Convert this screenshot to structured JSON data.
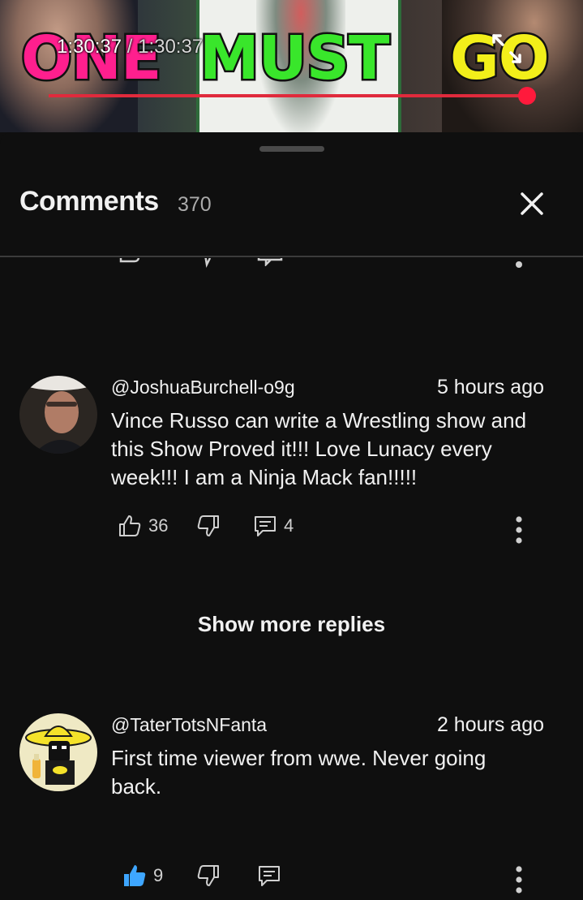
{
  "video": {
    "banner": {
      "word1": "ONE",
      "word2": "MUST",
      "word3": "GO"
    },
    "current_time": "1:30:37",
    "separator": " / ",
    "duration": "1:30:37",
    "progress_fraction": 1.0,
    "progress_color": "#ff1a3c"
  },
  "comments_panel": {
    "title": "Comments",
    "count": "370"
  },
  "comments": [
    {
      "handle": "@JoshuaBurchell-o9g",
      "time": "5 hours ago",
      "text": "Vince Russo can write a Wrestling show and this Show Proved it!!! Love Lunacy every week!!! I am a Ninja Mack fan!!!!!",
      "likes": "36",
      "replies": "4",
      "liked": false
    },
    {
      "handle": "@TaterTotsNFanta",
      "time": "2 hours ago",
      "text": "First time viewer from wwe. Never going back.",
      "likes": "9",
      "replies": "",
      "liked": true
    }
  ],
  "show_more_replies": "Show more replies",
  "colors": {
    "background": "#0f0f0f",
    "text": "#f1f1f1",
    "muted": "#aaaaaa",
    "liked_blue": "#3ea6ff"
  },
  "icons": [
    "fullscreen-icon",
    "close-icon",
    "like-icon",
    "dislike-icon",
    "reply-icon",
    "more-vert-icon"
  ]
}
